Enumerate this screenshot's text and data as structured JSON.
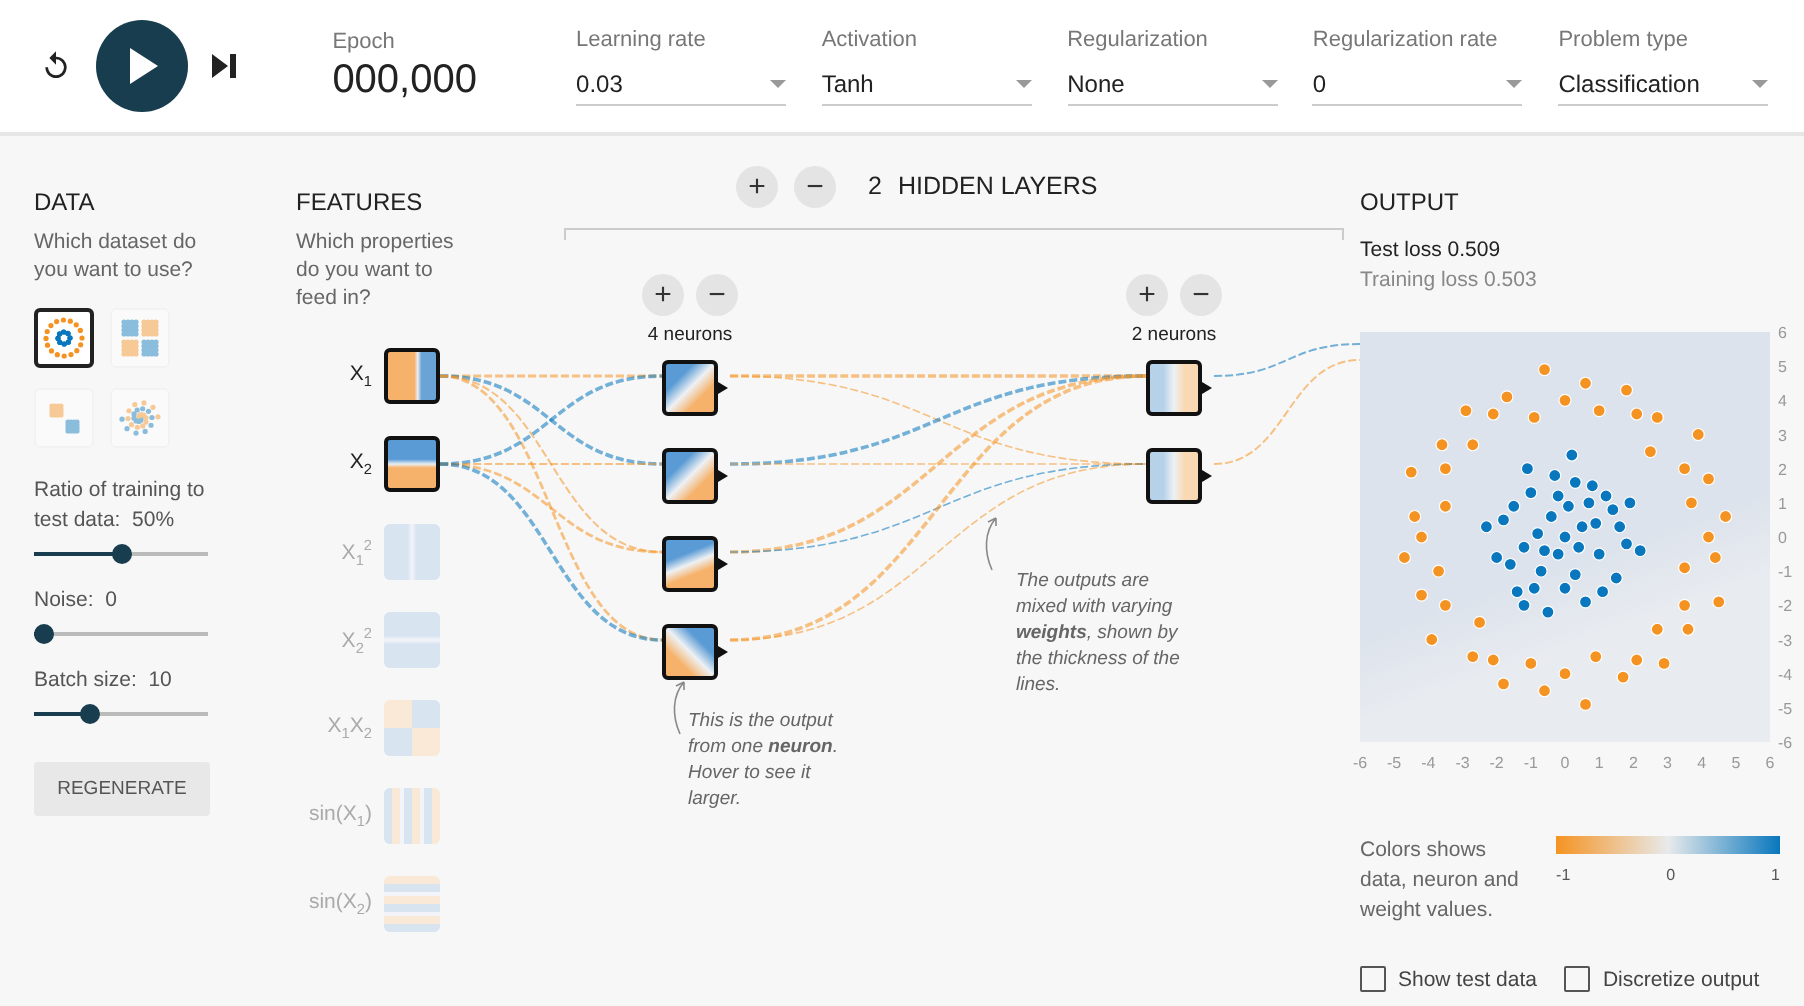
{
  "epoch": {
    "label": "Epoch",
    "value": "000,000"
  },
  "settings": [
    {
      "label": "Learning rate",
      "value": "0.03"
    },
    {
      "label": "Activation",
      "value": "Tanh"
    },
    {
      "label": "Regularization",
      "value": "None"
    },
    {
      "label": "Regularization rate",
      "value": "0"
    },
    {
      "label": "Problem type",
      "value": "Classification"
    }
  ],
  "data": {
    "title": "DATA",
    "prompt": "Which dataset do you want to use?",
    "datasets": [
      {
        "kind": "circle",
        "selected": true
      },
      {
        "kind": "xor",
        "selected": false
      },
      {
        "kind": "gauss",
        "selected": false
      },
      {
        "kind": "spiral",
        "selected": false
      }
    ],
    "sliders": [
      {
        "label": "Ratio of training to test data:",
        "reading": "50%",
        "level": 0.5
      },
      {
        "label": "Noise:",
        "reading": "0",
        "level": 0
      },
      {
        "label": "Batch size:",
        "reading": "10",
        "level": 0.3
      }
    ],
    "button": "REGENERATE"
  },
  "features": {
    "title": "FEATURES",
    "prompt": "Which properties do you want to feed in?",
    "items": [
      {
        "label": "X$_{1}$",
        "kind": "x1",
        "enabled": true
      },
      {
        "label": "X$_{2}$",
        "kind": "x2",
        "enabled": true
      },
      {
        "label": "X$_{1}$$^{2}$",
        "kind": "x1sq",
        "enabled": false
      },
      {
        "label": "X$_{2}$$^{2}$",
        "kind": "x2sq",
        "enabled": false
      },
      {
        "label": "X$_{1}$X$_{2}$",
        "kind": "x1x2",
        "enabled": false
      },
      {
        "label": "sin(X$_{1}$)",
        "kind": "sinx1",
        "enabled": false
      },
      {
        "label": "sin(X$_{2}$)",
        "kind": "sinx2",
        "enabled": false
      }
    ]
  },
  "network": {
    "add": "+",
    "remove": "−",
    "count": "2",
    "title": "HIDDEN LAYERS",
    "layers": [
      {
        "add": "+",
        "remove": "−",
        "label": "4 neurons",
        "neurons": [
          {
            "kind": "diagonal"
          },
          {
            "kind": "diagonal"
          },
          {
            "kind": "steep"
          },
          {
            "kind": "anti"
          }
        ]
      },
      {
        "add": "+",
        "remove": "−",
        "label": "2 neurons",
        "neurons": [
          {
            "kind": "vertical"
          },
          {
            "kind": "vertical"
          }
        ]
      }
    ]
  },
  "notes": [
    {
      "text": "This is the output from one **neuron**. Hover to see it larger."
    },
    {
      "text": "The outputs are mixed with varying **weights**, shown by the thickness of the lines."
    }
  ],
  "output": {
    "title": "OUTPUT",
    "test_loss": "Test loss 0.509",
    "training_loss": "Training loss 0.503",
    "chart_data": {
      "type": "scatter",
      "xlim": [
        -6,
        6
      ],
      "ylim": [
        -6,
        6
      ],
      "xticks": [
        -6,
        -5,
        -4,
        -3,
        -2,
        -1,
        0,
        1,
        2,
        3,
        4,
        5,
        6
      ],
      "yticks": [
        -6,
        -5,
        -4,
        -3,
        -2,
        -1,
        0,
        1,
        2,
        3,
        4,
        5,
        6
      ],
      "series": [
        {
          "color": "#f59322",
          "x": [
            4.2,
            4.7,
            3.7,
            4.2,
            3.5,
            3.9,
            2.5,
            2.7,
            2.1,
            1.8,
            1.0,
            0.6,
            0,
            -0.6,
            -0.9,
            -1.7,
            -2.1,
            -2.9,
            -2.7,
            -3.6,
            -3.5,
            -4.5,
            -3.5,
            -4.4,
            -4.2,
            -4.7,
            -3.7,
            -4.2,
            -3.5,
            -3.9,
            -2.5,
            -2.7,
            -2.1,
            -1.8,
            -1.0,
            -0.6,
            0,
            0.6,
            0.9,
            1.7,
            2.1,
            2.9,
            2.7,
            3.6,
            3.5,
            4.5,
            3.5,
            4.4
          ],
          "values": [
            0,
            0.6,
            1.0,
            1.7,
            2.0,
            3.0,
            2.5,
            3.5,
            3.6,
            4.3,
            3.7,
            4.5,
            4.0,
            4.9,
            3.5,
            4.1,
            3.6,
            3.7,
            2.7,
            2.7,
            2.0,
            1.9,
            0.9,
            0.6,
            0,
            -0.6,
            -1.0,
            -1.7,
            -2.0,
            -3.0,
            -2.5,
            -3.5,
            -3.6,
            -4.3,
            -3.7,
            -4.5,
            -4.0,
            -4.9,
            -3.5,
            -4.1,
            -3.6,
            -3.7,
            -2.7,
            -2.7,
            -2.0,
            -1.9,
            -0.9,
            -0.6
          ]
        },
        {
          "color": "#0877bd",
          "x": [
            0,
            0.5,
            -0.4,
            1.0,
            -1.2,
            0.3,
            -0.7,
            1.4,
            -1.5,
            0.8,
            -0.3,
            0.2,
            -1.1,
            1.8,
            -2.0,
            -1.8,
            0.6,
            -0.5,
            1.5,
            -1.4,
            2.2,
            -2.3,
            0.9,
            -0.8,
            0.1,
            -0.2,
            1.2,
            -1.0,
            0.4,
            -0.6,
            1.6,
            -1.6,
            0.7,
            -0.2,
            0.0,
            1.1,
            -1.2,
            1.9,
            -0.9,
            0.3
          ],
          "values": [
            0,
            0.3,
            0.6,
            -0.5,
            -0.3,
            -1.1,
            -1.0,
            0.8,
            0.9,
            1.5,
            1.8,
            2.4,
            2.0,
            -0.2,
            -0.6,
            0.5,
            -1.9,
            -2.2,
            -1.2,
            -1.6,
            -0.4,
            0.3,
            0.4,
            0.1,
            0.9,
            -0.5,
            1.2,
            1.3,
            -0.3,
            -0.4,
            0.3,
            -0.8,
            1.0,
            1.2,
            -1.5,
            -1.6,
            -2.0,
            1.0,
            -1.5,
            1.6
          ]
        }
      ]
    },
    "legend": {
      "text": "Colors shows data, neuron and weight values.",
      "ticks": [
        "-1",
        "0",
        "1"
      ]
    },
    "checkboxes": [
      {
        "label": "Show test data",
        "checked": false
      },
      {
        "label": "Discretize output",
        "checked": false
      }
    ]
  }
}
